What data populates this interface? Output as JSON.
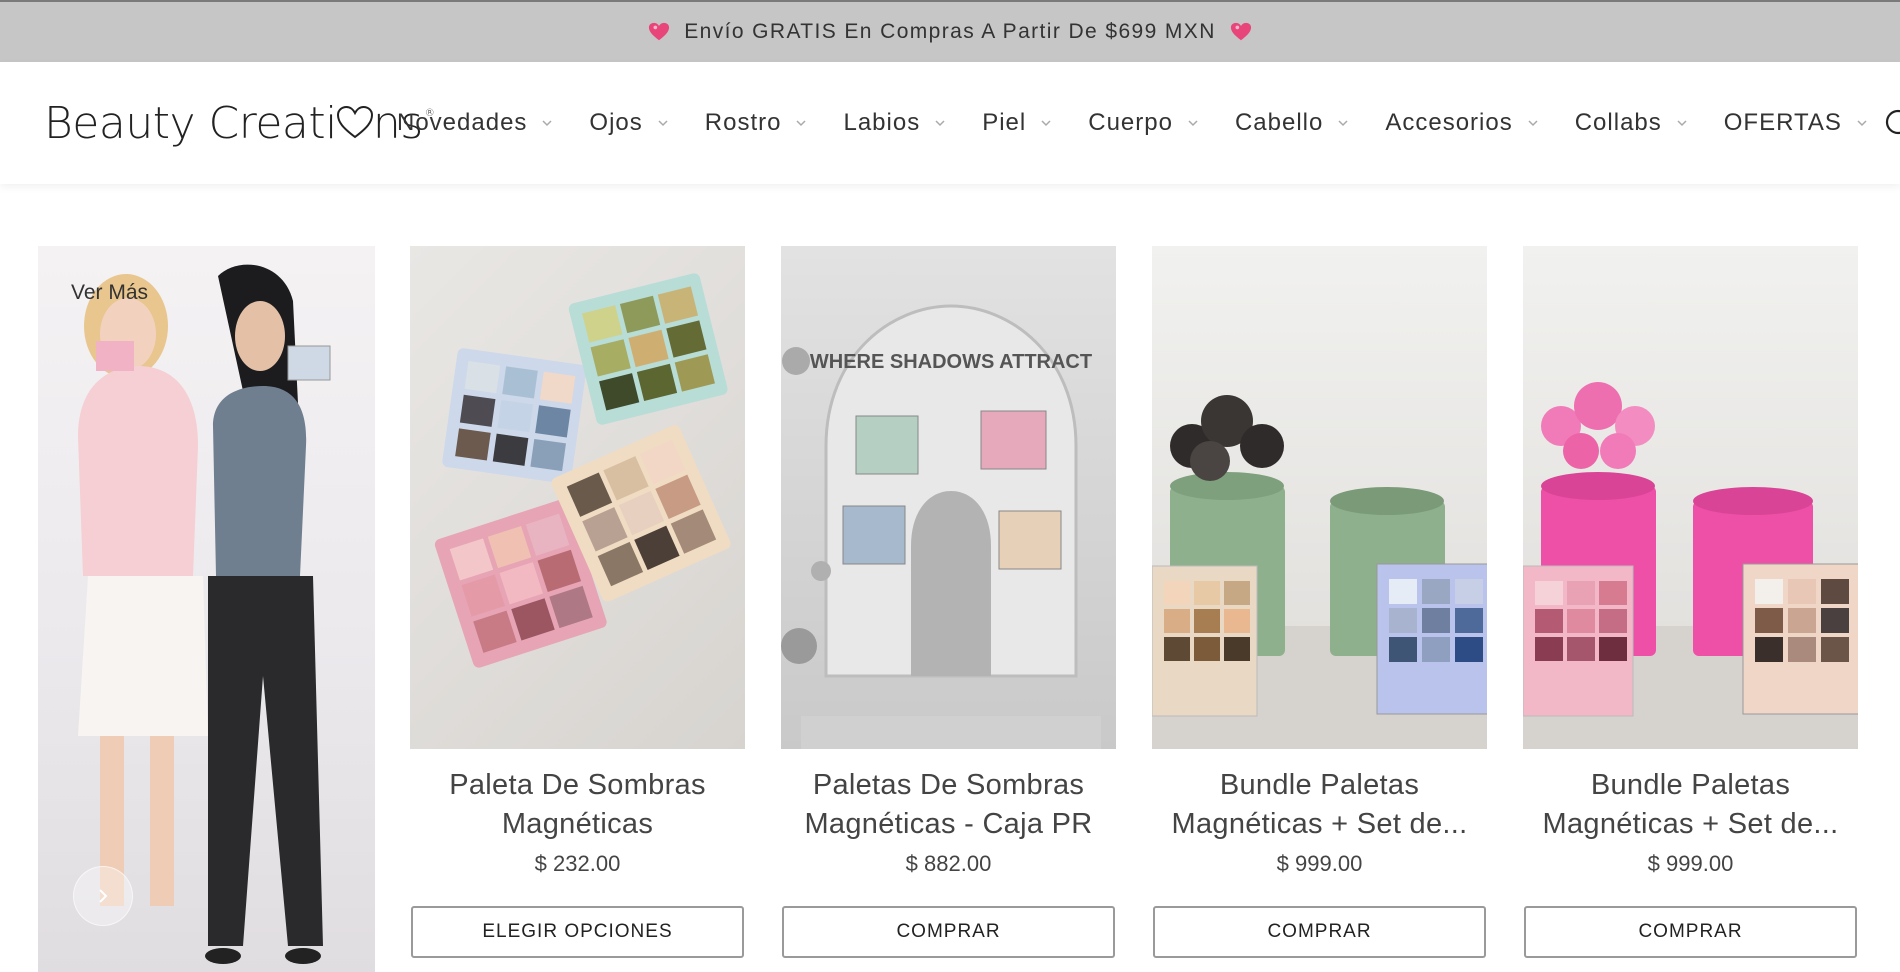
{
  "announcement": {
    "text": "Envío GRATIS En Compras A Partir De $699 MXN"
  },
  "header": {
    "logo": {
      "part1": "Beauty Creati",
      "part2": "ns",
      "reg": "®"
    },
    "nav": [
      {
        "label": "Novedades"
      },
      {
        "label": "Ojos"
      },
      {
        "label": "Rostro"
      },
      {
        "label": "Labios"
      },
      {
        "label": "Piel"
      },
      {
        "label": "Cuerpo"
      },
      {
        "label": "Cabello"
      },
      {
        "label": "Accesorios"
      },
      {
        "label": "Collabs"
      },
      {
        "label": "OFERTAS"
      }
    ]
  },
  "hero": {
    "label": "Ver Más"
  },
  "products": [
    {
      "title_line1": "Paleta De Sombras",
      "title_line2": "Magnéticas",
      "price": "$ 232.00",
      "button": "ELEGIR OPCIONES"
    },
    {
      "title_line1": "Paletas De Sombras",
      "title_line2": "Magnéticas - Caja PR",
      "price": "$ 882.00",
      "button": "COMPRAR",
      "display_text": "WHERE SHADOWS ATTRACT"
    },
    {
      "title_line1": "Bundle Paletas",
      "title_line2": "Magnéticas + Set de...",
      "price": "$ 999.00",
      "button": "COMPRAR"
    },
    {
      "title_line1": "Bundle Paletas",
      "title_line2": "Magnéticas + Set de...",
      "price": "$ 999.00",
      "button": "COMPRAR"
    }
  ],
  "colors": {
    "announce_bg": "#c6c6c6",
    "heart": "#e8457a",
    "button_border": "#9a9a9a"
  },
  "icons": [
    "heart-icon",
    "chevron-down-icon",
    "search-icon",
    "chevron-right-icon"
  ]
}
